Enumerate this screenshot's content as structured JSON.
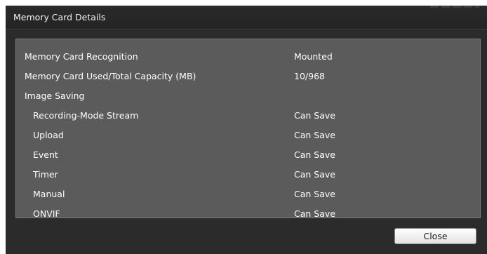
{
  "dialog": {
    "title": "Memory Card Details",
    "close_label": "Close"
  },
  "rows": [
    {
      "label": "Memory Card Recognition",
      "value": "Mounted",
      "indent": 0
    },
    {
      "label": "Memory Card Used/Total Capacity (MB)",
      "value": "10/968",
      "indent": 0
    },
    {
      "label": "Image Saving",
      "value": "",
      "indent": 0
    },
    {
      "label": "Recording-Mode Stream",
      "value": "Can Save",
      "indent": 1
    },
    {
      "label": "Upload",
      "value": "Can Save",
      "indent": 1
    },
    {
      "label": "Event",
      "value": "Can Save",
      "indent": 1
    },
    {
      "label": "Timer",
      "value": "Can Save",
      "indent": 1
    },
    {
      "label": "Manual",
      "value": "Can Save",
      "indent": 1
    },
    {
      "label": "ONVIF",
      "value": "Can Save",
      "indent": 1
    }
  ]
}
